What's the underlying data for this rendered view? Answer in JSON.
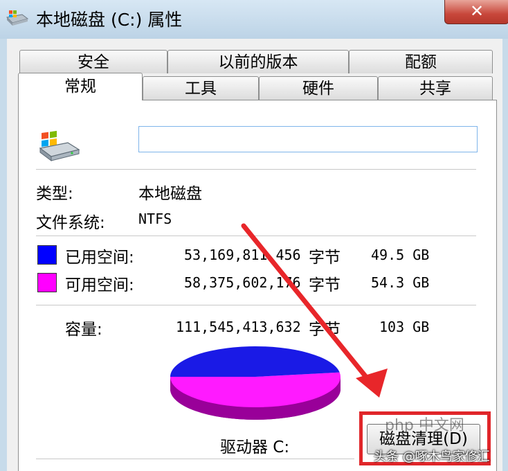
{
  "window": {
    "title": "本地磁盘 (C:) 属性",
    "close_glyph": "✕"
  },
  "tabs": {
    "row1": [
      "安全",
      "以前的版本",
      "配额"
    ],
    "row2": [
      "常规",
      "工具",
      "硬件",
      "共享"
    ],
    "active": "常规"
  },
  "general": {
    "name_value": "",
    "type_label": "类型:",
    "type_value": "本地磁盘",
    "fs_label": "文件系统:",
    "fs_value": "NTFS",
    "used": {
      "label": "已用空间:",
      "bytes": "53,169,811,456",
      "unit": "字节",
      "size": "49.5 GB",
      "color": "#0000ff"
    },
    "free": {
      "label": "可用空间:",
      "bytes": "58,375,602,176",
      "unit": "字节",
      "size": "54.3 GB",
      "color": "#ff00ff"
    },
    "capacity": {
      "label": "容量:",
      "bytes": "111,545,413,632",
      "unit": "字节",
      "size": "103 GB"
    },
    "drive_label": "驱动器 C:",
    "cleanup_button": "磁盘清理(D)"
  },
  "pie": {
    "used_fraction": 0.477,
    "used_color": "#1a1ae6",
    "free_color": "#ff1aff"
  },
  "watermarks": {
    "php": "php 中文网",
    "author": "头条 @啄木鸟家修汇"
  }
}
